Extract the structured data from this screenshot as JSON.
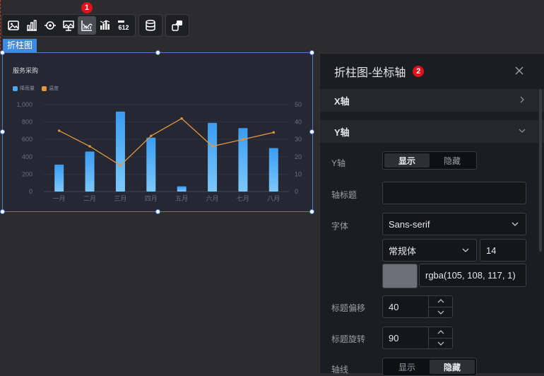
{
  "toolbar": {
    "badge1": "1",
    "icons": [
      "image-icon",
      "bar-chart-icon",
      "target-icon",
      "map-flag-icon",
      "bar-line-chart-icon",
      "histogram-icon",
      "number-icon",
      "database-icon",
      "share-icon"
    ],
    "number_icon_text": "612"
  },
  "chart_tag": "折柱图",
  "chart_data": {
    "type": "bar",
    "title": "服务采购",
    "categories": [
      "一月",
      "二月",
      "三月",
      "四月",
      "五月",
      "六月",
      "七月",
      "八月"
    ],
    "series": [
      {
        "name": "降雨量",
        "type": "bar",
        "values": [
          310,
          460,
          920,
          620,
          60,
          790,
          730,
          500
        ],
        "axis": "left"
      },
      {
        "name": "温度",
        "type": "line",
        "values": [
          35,
          26,
          15,
          32,
          42,
          26,
          30,
          34
        ],
        "axis": "right"
      }
    ],
    "ylim_left": [
      0,
      1000
    ],
    "yticks_left": [
      "0",
      "200",
      "400",
      "600",
      "800",
      "1,000"
    ],
    "ylim_right": [
      0,
      50
    ],
    "yticks_right": [
      "0",
      "10",
      "20",
      "30",
      "40",
      "50"
    ],
    "colors": {
      "bar": "#4aa8f5",
      "line": "#e3963e"
    }
  },
  "panel": {
    "title": "折柱图-坐标轴",
    "badge2": "2",
    "x_axis_section": "X轴",
    "y_axis_section": "Y轴",
    "y_axis_label": "Y轴",
    "show": "显示",
    "hide": "隐藏",
    "axis_title_label": "轴标题",
    "axis_title_value": "",
    "font_label": "字体",
    "font_family": "Sans-serif",
    "font_weight": "常规体",
    "font_size": "14",
    "font_color": "rgba(105, 108, 117, 1)",
    "title_offset_label": "标题偏移",
    "title_offset_value": "40",
    "title_rotate_label": "标题旋转",
    "title_rotate_value": "90",
    "axis_line_label": "轴线",
    "axis_line_show": "显示",
    "axis_line_hide": "隐藏"
  }
}
